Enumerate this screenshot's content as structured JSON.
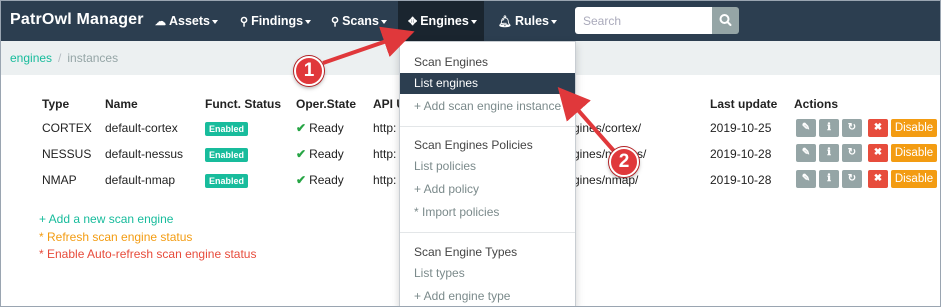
{
  "navbar": {
    "brand": "PatrOwl Manager",
    "items": [
      {
        "label": "Assets",
        "icon": "cloud-icon"
      },
      {
        "label": "Findings",
        "icon": "map-marker-icon"
      },
      {
        "label": "Scans",
        "icon": "search-icon"
      },
      {
        "label": "Engines",
        "icon": "crosshairs-icon"
      },
      {
        "label": "Rules",
        "icon": "bell-icon"
      }
    ],
    "search_placeholder": "Search"
  },
  "breadcrumb": {
    "link": "engines",
    "separator": "/",
    "current": "instances"
  },
  "table": {
    "headers": [
      "Type",
      "Name",
      "Funct. Status",
      "Oper.State",
      "API URL",
      "Last update",
      "Actions"
    ],
    "rows": [
      {
        "type": "CORTEX",
        "name": "default-cortex",
        "status": "Enabled",
        "state": "Ready",
        "api": "http:",
        "api_tail": "gines/cortex/",
        "updated": "2019-10-25"
      },
      {
        "type": "NESSUS",
        "name": "default-nessus",
        "status": "Enabled",
        "state": "Ready",
        "api": "http:",
        "api_tail": "gines/nessus/",
        "updated": "2019-10-28"
      },
      {
        "type": "NMAP",
        "name": "default-nmap",
        "status": "Enabled",
        "state": "Ready",
        "api": "http:",
        "api_tail": "gines/nmap/",
        "updated": "2019-10-28"
      }
    ],
    "disable_label": "Disable"
  },
  "links": {
    "add": "+ Add a new scan engine",
    "refresh": "* Refresh scan engine status",
    "auto_refresh": "* Enable Auto-refresh scan engine status"
  },
  "dropdown": {
    "sections": [
      {
        "header": "Scan Engines",
        "items": [
          "List engines",
          "+ Add scan engine instance"
        ]
      },
      {
        "header": "Scan Engines Policies",
        "items": [
          "List policies",
          "+ Add policy",
          "* Import policies"
        ]
      },
      {
        "header": "Scan Engine Types",
        "items": [
          "List types",
          "+ Add engine type"
        ]
      }
    ],
    "active_item": "List engines"
  },
  "callouts": [
    "1",
    "2"
  ],
  "colors": {
    "navbar": "#2c3e50",
    "accent": "#18bc9c",
    "warning": "#f39c12",
    "danger": "#e74c3c",
    "callout": "#e0383b"
  }
}
